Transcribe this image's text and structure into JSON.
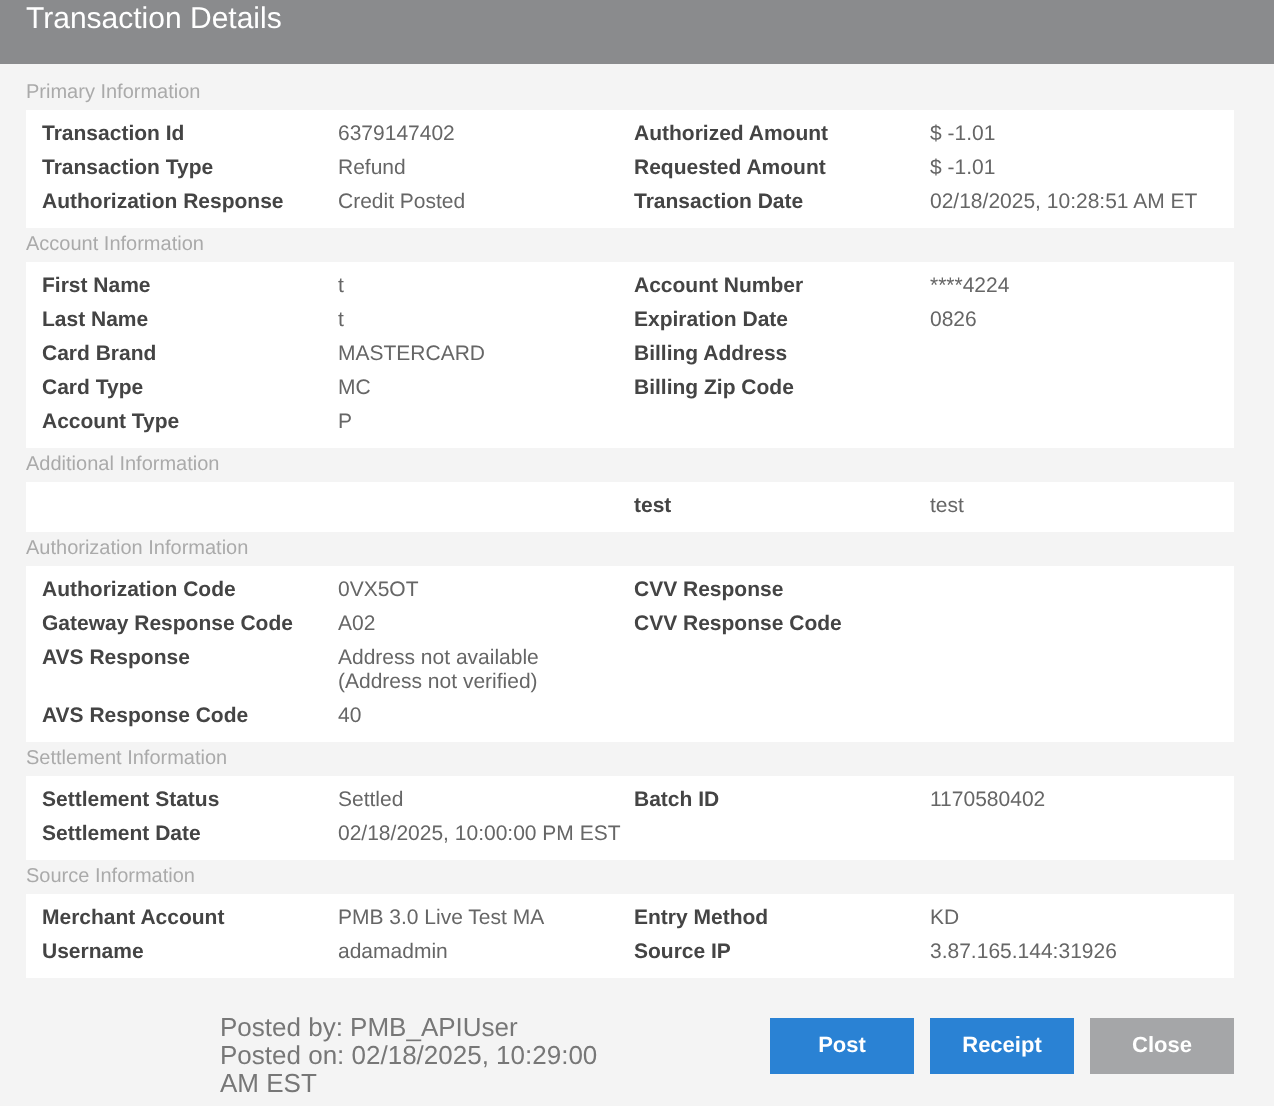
{
  "window": {
    "title": "Transaction Details"
  },
  "sections": [
    {
      "title": "Primary Information",
      "rows": [
        {
          "left": {
            "label": "Transaction Id",
            "value": "6379147402"
          },
          "right": {
            "label": "Authorized Amount",
            "value": "$ -1.01"
          }
        },
        {
          "left": {
            "label": "Transaction Type",
            "value": "Refund"
          },
          "right": {
            "label": "Requested Amount",
            "value": "$ -1.01"
          }
        },
        {
          "left": {
            "label": "Authorization Response",
            "value": "Credit Posted"
          },
          "right": {
            "label": "Transaction Date",
            "value": "02/18/2025, 10:28:51 AM ET"
          }
        }
      ]
    },
    {
      "title": "Account Information",
      "rows": [
        {
          "left": {
            "label": "First Name",
            "value": "t"
          },
          "right": {
            "label": "Account Number",
            "value": "****4224"
          }
        },
        {
          "left": {
            "label": "Last Name",
            "value": "t"
          },
          "right": {
            "label": "Expiration Date",
            "value": "0826"
          }
        },
        {
          "left": {
            "label": "Card Brand",
            "value": "MASTERCARD"
          },
          "right": {
            "label": "Billing Address"
          }
        },
        {
          "left": {
            "label": "Card Type",
            "value": "MC"
          },
          "right": {
            "label": "Billing Zip Code"
          }
        },
        {
          "left": {
            "label": "Account Type",
            "value": "P"
          }
        }
      ]
    },
    {
      "title": "Additional Information",
      "rows": [
        {
          "right": {
            "label": "test",
            "value": "test"
          }
        }
      ]
    },
    {
      "title": "Authorization Information",
      "rows": [
        {
          "left": {
            "label": "Authorization Code",
            "value": "0VX5OT"
          },
          "right": {
            "label": "CVV Response"
          }
        },
        {
          "left": {
            "label": "Gateway Response Code",
            "value": "A02"
          },
          "right": {
            "label": "CVV Response Code"
          }
        },
        {
          "left": {
            "label": "AVS Response",
            "value": "Address not available (Address not verified)"
          }
        },
        {
          "left": {
            "label": "AVS Response Code",
            "value": "40"
          }
        }
      ]
    },
    {
      "title": "Settlement Information",
      "rows": [
        {
          "left": {
            "label": "Settlement Status",
            "value": "Settled"
          },
          "right": {
            "label": "Batch ID",
            "value": "1170580402"
          }
        },
        {
          "left": {
            "label": "Settlement Date",
            "value": "02/18/2025, 10:00:00 PM EST"
          }
        }
      ]
    },
    {
      "title": "Source Information",
      "rows": [
        {
          "left": {
            "label": "Merchant Account",
            "value": "PMB 3.0 Live Test MA"
          },
          "right": {
            "label": "Entry Method",
            "value": "KD"
          }
        },
        {
          "left": {
            "label": "Username",
            "value": "adamadmin"
          },
          "right": {
            "label": "Source IP",
            "value": "3.87.165.144:31926"
          }
        }
      ]
    }
  ],
  "footer": {
    "posted_by": "Posted by: PMB_APIUser",
    "posted_on": "Posted on: 02/18/2025, 10:29:00 AM EST",
    "buttons": [
      {
        "label": "Post",
        "kind": "primary"
      },
      {
        "label": "Receipt",
        "kind": "primary"
      },
      {
        "label": "Close",
        "kind": "secondary"
      }
    ]
  }
}
